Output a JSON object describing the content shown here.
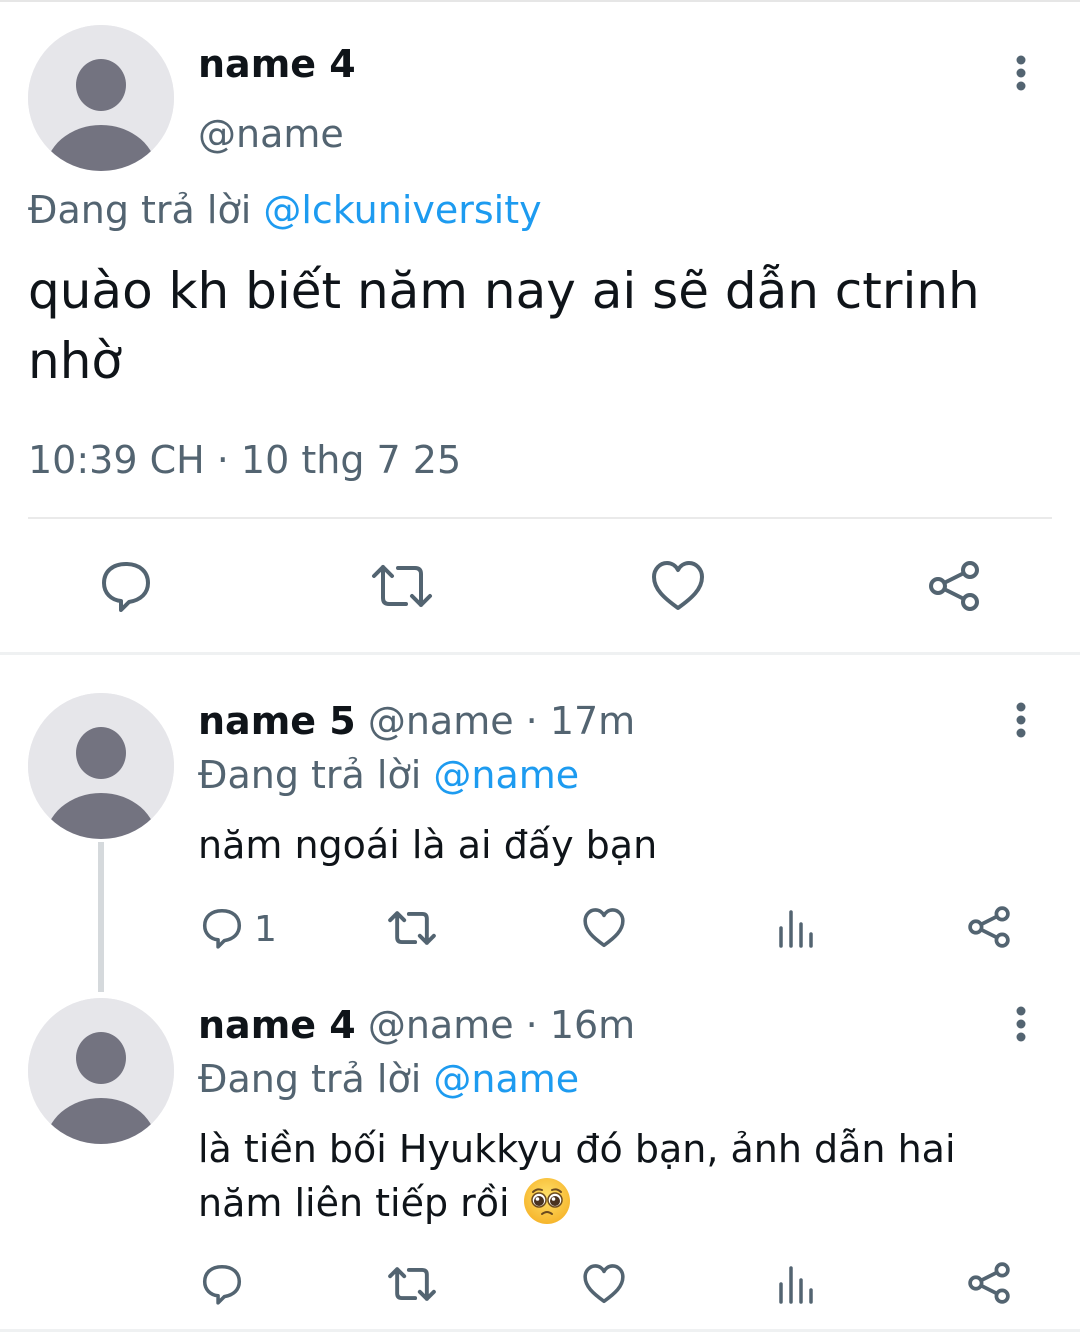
{
  "main_tweet": {
    "name": "name 4",
    "handle": "@name",
    "replying_prefix": "Đang trả lời ",
    "replying_to": "@lckuniversity",
    "text": "quào kh biết năm nay ai sẽ dẫn ctrinh nhờ",
    "timestamp": "10:39 CH · 10 thg 7 25"
  },
  "replies": [
    {
      "name": "name 5",
      "handle": "@name",
      "time": " · 17m",
      "replying_prefix": "Đang trả lời ",
      "replying_to": "@name",
      "text": "năm ngoái là ai đấy bạn",
      "reply_count": "1"
    },
    {
      "name": "name 4",
      "handle": "@name",
      "time": " · 16m",
      "replying_prefix": "Đang trả lời ",
      "replying_to": "@name",
      "text": "là tiền bối Hyukkyu đó bạn, ảnh dẫn hai năm liên tiếp rồi ",
      "emoji": "pleading-face"
    }
  ],
  "colors": {
    "text": "#0f1419",
    "secondary": "#536471",
    "link": "#1d9bf0",
    "avatar_bg": "#e6e6ea",
    "avatar_fg": "#737380"
  }
}
